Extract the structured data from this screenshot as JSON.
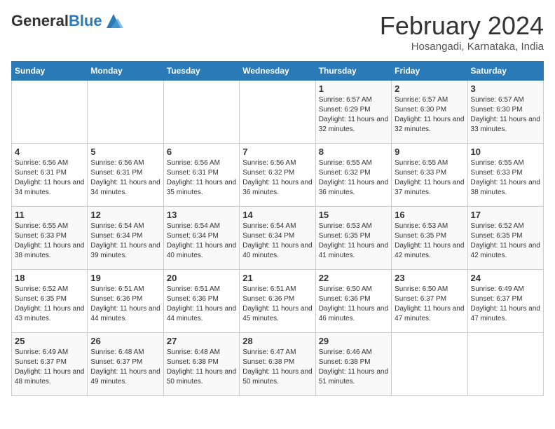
{
  "header": {
    "logo_general": "General",
    "logo_blue": "Blue",
    "month_title": "February 2024",
    "subtitle": "Hosangadi, Karnataka, India"
  },
  "weekdays": [
    "Sunday",
    "Monday",
    "Tuesday",
    "Wednesday",
    "Thursday",
    "Friday",
    "Saturday"
  ],
  "weeks": [
    [
      {
        "day": "",
        "info": ""
      },
      {
        "day": "",
        "info": ""
      },
      {
        "day": "",
        "info": ""
      },
      {
        "day": "",
        "info": ""
      },
      {
        "day": "1",
        "info": "Sunrise: 6:57 AM\nSunset: 6:29 PM\nDaylight: 11 hours and 32 minutes."
      },
      {
        "day": "2",
        "info": "Sunrise: 6:57 AM\nSunset: 6:30 PM\nDaylight: 11 hours and 32 minutes."
      },
      {
        "day": "3",
        "info": "Sunrise: 6:57 AM\nSunset: 6:30 PM\nDaylight: 11 hours and 33 minutes."
      }
    ],
    [
      {
        "day": "4",
        "info": "Sunrise: 6:56 AM\nSunset: 6:31 PM\nDaylight: 11 hours and 34 minutes."
      },
      {
        "day": "5",
        "info": "Sunrise: 6:56 AM\nSunset: 6:31 PM\nDaylight: 11 hours and 34 minutes."
      },
      {
        "day": "6",
        "info": "Sunrise: 6:56 AM\nSunset: 6:31 PM\nDaylight: 11 hours and 35 minutes."
      },
      {
        "day": "7",
        "info": "Sunrise: 6:56 AM\nSunset: 6:32 PM\nDaylight: 11 hours and 36 minutes."
      },
      {
        "day": "8",
        "info": "Sunrise: 6:55 AM\nSunset: 6:32 PM\nDaylight: 11 hours and 36 minutes."
      },
      {
        "day": "9",
        "info": "Sunrise: 6:55 AM\nSunset: 6:33 PM\nDaylight: 11 hours and 37 minutes."
      },
      {
        "day": "10",
        "info": "Sunrise: 6:55 AM\nSunset: 6:33 PM\nDaylight: 11 hours and 38 minutes."
      }
    ],
    [
      {
        "day": "11",
        "info": "Sunrise: 6:55 AM\nSunset: 6:33 PM\nDaylight: 11 hours and 38 minutes."
      },
      {
        "day": "12",
        "info": "Sunrise: 6:54 AM\nSunset: 6:34 PM\nDaylight: 11 hours and 39 minutes."
      },
      {
        "day": "13",
        "info": "Sunrise: 6:54 AM\nSunset: 6:34 PM\nDaylight: 11 hours and 40 minutes."
      },
      {
        "day": "14",
        "info": "Sunrise: 6:54 AM\nSunset: 6:34 PM\nDaylight: 11 hours and 40 minutes."
      },
      {
        "day": "15",
        "info": "Sunrise: 6:53 AM\nSunset: 6:35 PM\nDaylight: 11 hours and 41 minutes."
      },
      {
        "day": "16",
        "info": "Sunrise: 6:53 AM\nSunset: 6:35 PM\nDaylight: 11 hours and 42 minutes."
      },
      {
        "day": "17",
        "info": "Sunrise: 6:52 AM\nSunset: 6:35 PM\nDaylight: 11 hours and 42 minutes."
      }
    ],
    [
      {
        "day": "18",
        "info": "Sunrise: 6:52 AM\nSunset: 6:35 PM\nDaylight: 11 hours and 43 minutes."
      },
      {
        "day": "19",
        "info": "Sunrise: 6:51 AM\nSunset: 6:36 PM\nDaylight: 11 hours and 44 minutes."
      },
      {
        "day": "20",
        "info": "Sunrise: 6:51 AM\nSunset: 6:36 PM\nDaylight: 11 hours and 44 minutes."
      },
      {
        "day": "21",
        "info": "Sunrise: 6:51 AM\nSunset: 6:36 PM\nDaylight: 11 hours and 45 minutes."
      },
      {
        "day": "22",
        "info": "Sunrise: 6:50 AM\nSunset: 6:36 PM\nDaylight: 11 hours and 46 minutes."
      },
      {
        "day": "23",
        "info": "Sunrise: 6:50 AM\nSunset: 6:37 PM\nDaylight: 11 hours and 47 minutes."
      },
      {
        "day": "24",
        "info": "Sunrise: 6:49 AM\nSunset: 6:37 PM\nDaylight: 11 hours and 47 minutes."
      }
    ],
    [
      {
        "day": "25",
        "info": "Sunrise: 6:49 AM\nSunset: 6:37 PM\nDaylight: 11 hours and 48 minutes."
      },
      {
        "day": "26",
        "info": "Sunrise: 6:48 AM\nSunset: 6:37 PM\nDaylight: 11 hours and 49 minutes."
      },
      {
        "day": "27",
        "info": "Sunrise: 6:48 AM\nSunset: 6:38 PM\nDaylight: 11 hours and 50 minutes."
      },
      {
        "day": "28",
        "info": "Sunrise: 6:47 AM\nSunset: 6:38 PM\nDaylight: 11 hours and 50 minutes."
      },
      {
        "day": "29",
        "info": "Sunrise: 6:46 AM\nSunset: 6:38 PM\nDaylight: 11 hours and 51 minutes."
      },
      {
        "day": "",
        "info": ""
      },
      {
        "day": "",
        "info": ""
      }
    ]
  ]
}
